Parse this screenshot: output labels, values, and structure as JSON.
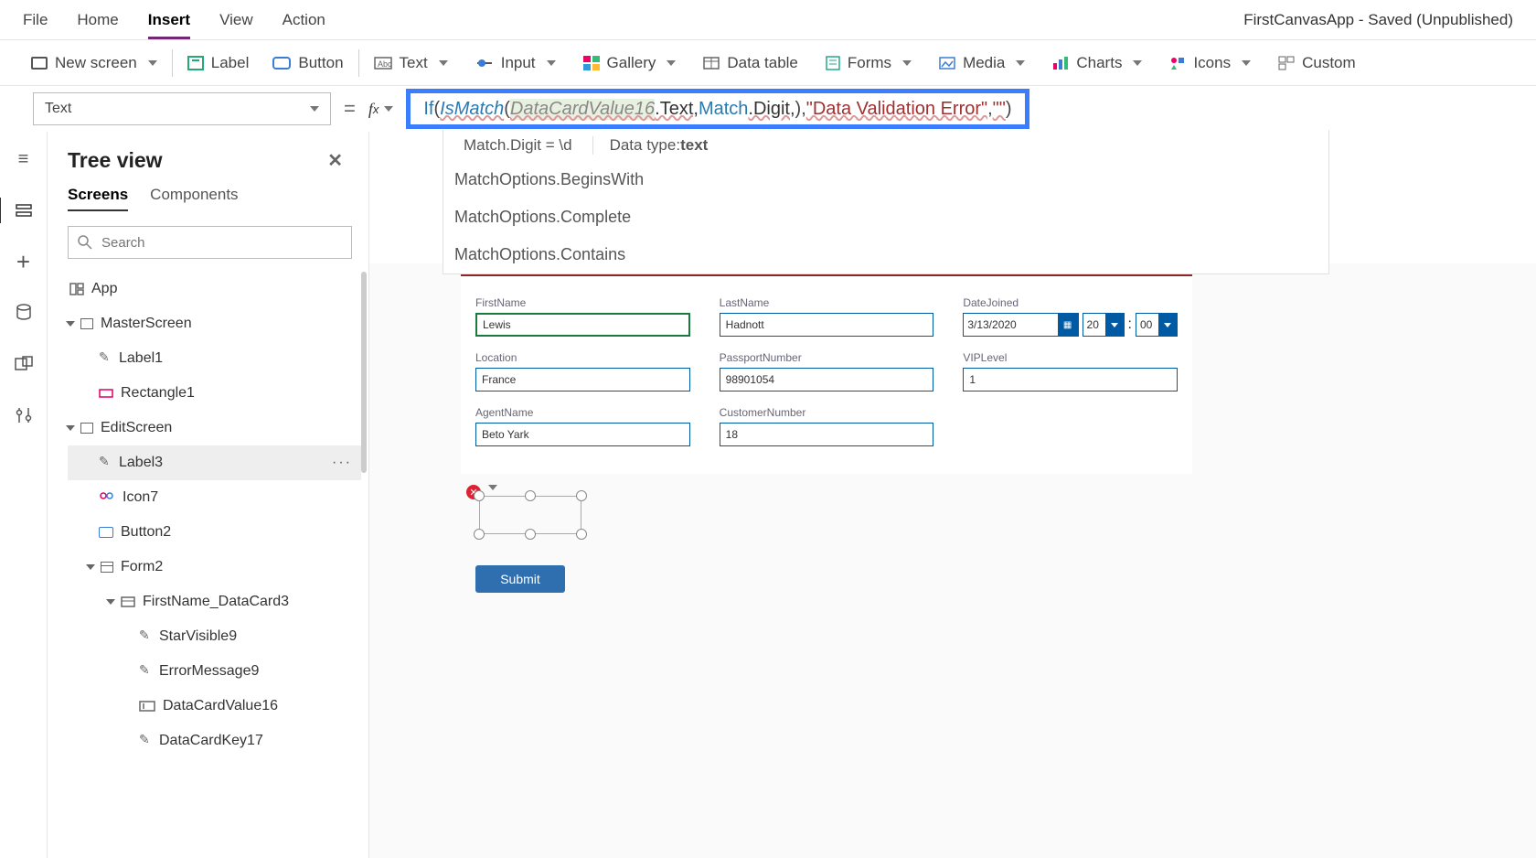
{
  "app_title": "FirstCanvasApp - Saved (Unpublished)",
  "menu": {
    "file": "File",
    "home": "Home",
    "insert": "Insert",
    "view": "View",
    "action": "Action"
  },
  "ribbon": {
    "new_screen": "New screen",
    "label": "Label",
    "button": "Button",
    "text": "Text",
    "input": "Input",
    "gallery": "Gallery",
    "data_table": "Data table",
    "forms": "Forms",
    "media": "Media",
    "charts": "Charts",
    "icons": "Icons",
    "custom": "Custom"
  },
  "property": {
    "name": "Text"
  },
  "formula": {
    "kw_if": "If",
    "p1": "(",
    "fn": "IsMatch",
    "p2": "(",
    "var": "DataCardValue16",
    "dot_text": ".Text, ",
    "match": "Match",
    "dot_digit": ".Digit, ",
    "p3": "), ",
    "str1": "\"Data Validation Error\"",
    "comma": ", ",
    "str2": "\"\"",
    "p4": ")"
  },
  "hint": {
    "left": "Match.Digit  =  \\d",
    "dt_label": "Data type: ",
    "dt_value": "text"
  },
  "suggestions": [
    "MatchOptions.BeginsWith",
    "MatchOptions.Complete",
    "MatchOptions.Contains"
  ],
  "tree": {
    "title": "Tree view",
    "tabs": {
      "screens": "Screens",
      "components": "Components"
    },
    "search_placeholder": "Search",
    "items": {
      "app": "App",
      "master": "MasterScreen",
      "label1": "Label1",
      "rect1": "Rectangle1",
      "edit": "EditScreen",
      "label3": "Label3",
      "icon7": "Icon7",
      "button2": "Button2",
      "form2": "Form2",
      "dc": "FirstName_DataCard3",
      "star": "StarVisible9",
      "err": "ErrorMessage9",
      "val": "DataCardValue16",
      "key": "DataCardKey17"
    }
  },
  "form": {
    "first": {
      "label": "FirstName",
      "value": "Lewis"
    },
    "last": {
      "label": "LastName",
      "value": "Hadnott"
    },
    "date": {
      "label": "DateJoined",
      "value": "3/13/2020",
      "hh": "20",
      "mm": "00"
    },
    "loc": {
      "label": "Location",
      "value": "France"
    },
    "pass": {
      "label": "PassportNumber",
      "value": "98901054"
    },
    "vip": {
      "label": "VIPLevel",
      "value": "1"
    },
    "agent": {
      "label": "AgentName",
      "value": "Beto Yark"
    },
    "cust": {
      "label": "CustomerNumber",
      "value": "18"
    },
    "submit": "Submit"
  }
}
